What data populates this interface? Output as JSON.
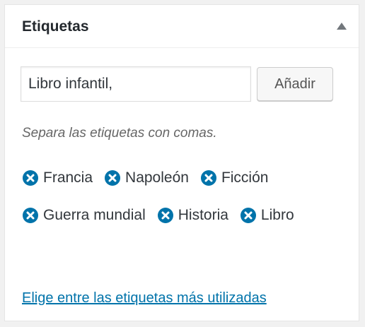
{
  "panel": {
    "title": "Etiquetas",
    "toggle_icon": "triangle-up-icon"
  },
  "tag_input": {
    "value": "Libro infantil,",
    "placeholder": ""
  },
  "add_button": {
    "label": "Añadir"
  },
  "hint": "Separa las etiquetas con comas.",
  "tags": [
    {
      "label": "Francia"
    },
    {
      "label": "Napoleón"
    },
    {
      "label": "Ficción"
    },
    {
      "label": "Guerra mundial"
    },
    {
      "label": "Historia"
    },
    {
      "label": "Libro"
    }
  ],
  "remove_icon": "remove-circle-icon",
  "popular_link": "Elige entre las etiquetas más utilizadas",
  "colors": {
    "accent": "#0073aa",
    "remove_icon": "#0073aa",
    "toggle_icon": "#72777c"
  }
}
